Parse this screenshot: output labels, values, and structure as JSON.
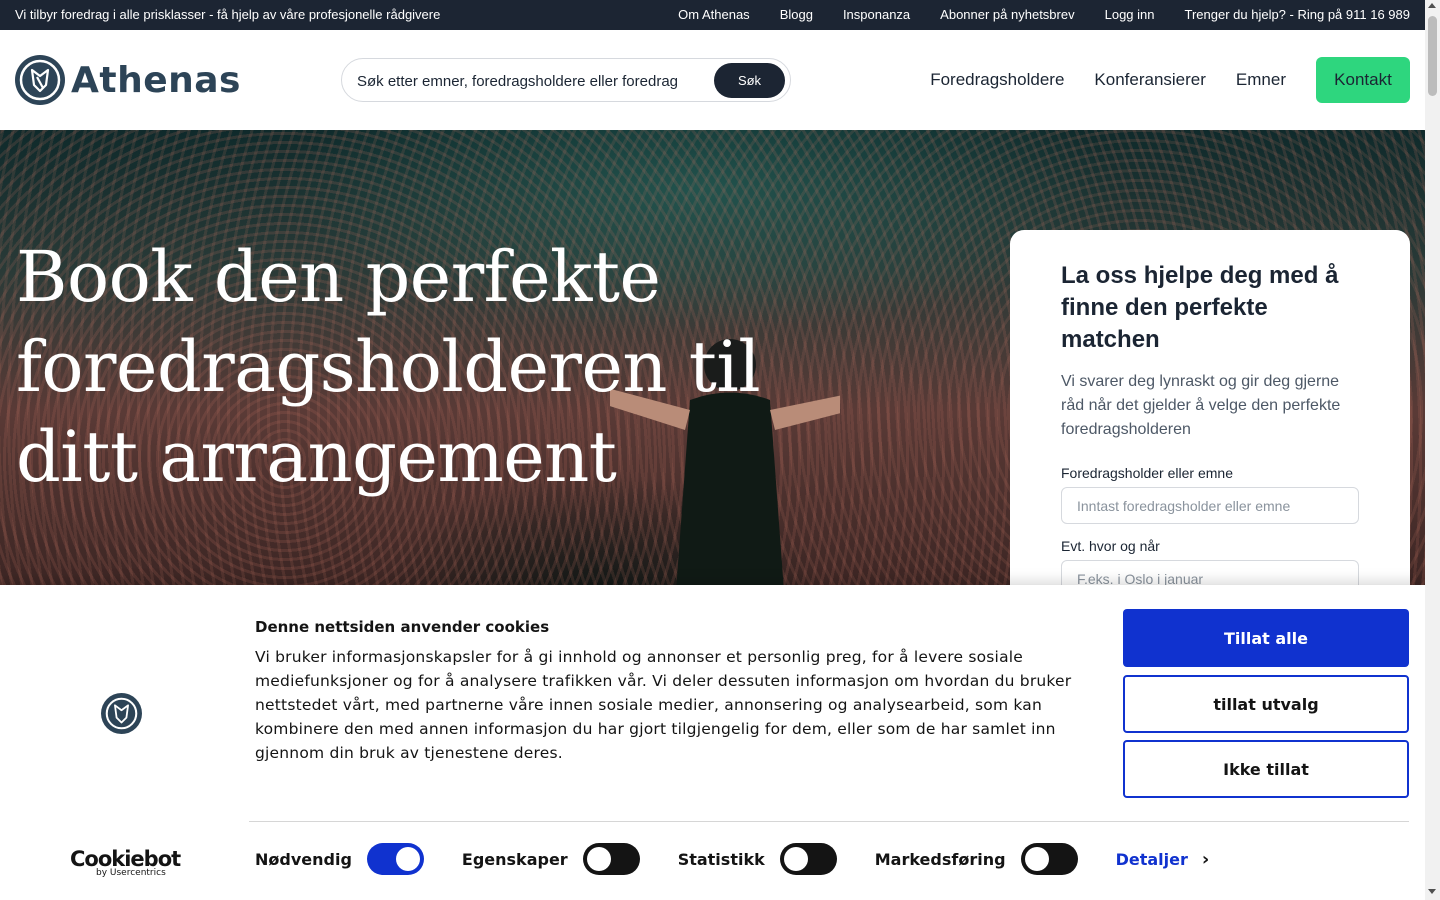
{
  "topbar": {
    "promo": "Vi tilbyr foredrag i alle prisklasser - få hjelp av våre profesjonelle rådgivere",
    "links": [
      "Om Athenas",
      "Blogg",
      "Insponanza",
      "Abonner på nyhetsbrev",
      "Logg inn",
      "Trenger du hjelp? - Ring på 911 16 989"
    ]
  },
  "header": {
    "logo_text": "Athenas",
    "search_placeholder": "Søk etter emner, foredragsholdere eller foredrag",
    "search_button": "Søk",
    "nav": [
      "Foredragsholdere",
      "Konferansierer",
      "Emner"
    ],
    "contact_button": "Kontakt"
  },
  "hero": {
    "title": "Book den perfekte foredragsholderen til ditt arrangement"
  },
  "form": {
    "title": "La oss hjelpe deg med å finne den perfekte matchen",
    "description": "Vi svarer deg lynraskt og gir deg gjerne råd når det gjelder å velge den perfekte foredragsholderen",
    "field1_label": "Foredragsholder eller emne",
    "field1_placeholder": "Inntast foredragsholder eller emne",
    "field2_label": "Evt. hvor og når",
    "field2_placeholder": "F.eks. i Oslo i januar"
  },
  "cookie": {
    "title": "Denne nettsiden anvender cookies",
    "text": "Vi bruker informasjonskapsler for å gi innhold og annonser et personlig preg, for å levere sosiale mediefunksjoner og for å analysere trafikken vår. Vi deler dessuten informasjon om hvordan du bruker nettstedet vårt, med partnerne våre innen sosiale medier, annonsering og analysearbeid, som kan kombinere den med annen informasjon du har gjort tilgjengelig for dem, eller som de har samlet inn gjennom din bruk av tjenestene deres.",
    "allow_all": "Tillat alle",
    "allow_selection": "tillat utvalg",
    "deny": "Ikke tillat",
    "brand_name": "Cookiebot",
    "brand_by": "by Usercentrics",
    "toggles": [
      {
        "label": "Nødvendig",
        "on": true
      },
      {
        "label": "Egenskaper",
        "on": false
      },
      {
        "label": "Statistikk",
        "on": false
      },
      {
        "label": "Markedsføring",
        "on": false
      }
    ],
    "details": "Detaljer"
  },
  "colors": {
    "dark": "#1c2533",
    "brand": "#2d4457",
    "accent_green": "#2ed67e",
    "cookie_blue": "#1032cf"
  }
}
